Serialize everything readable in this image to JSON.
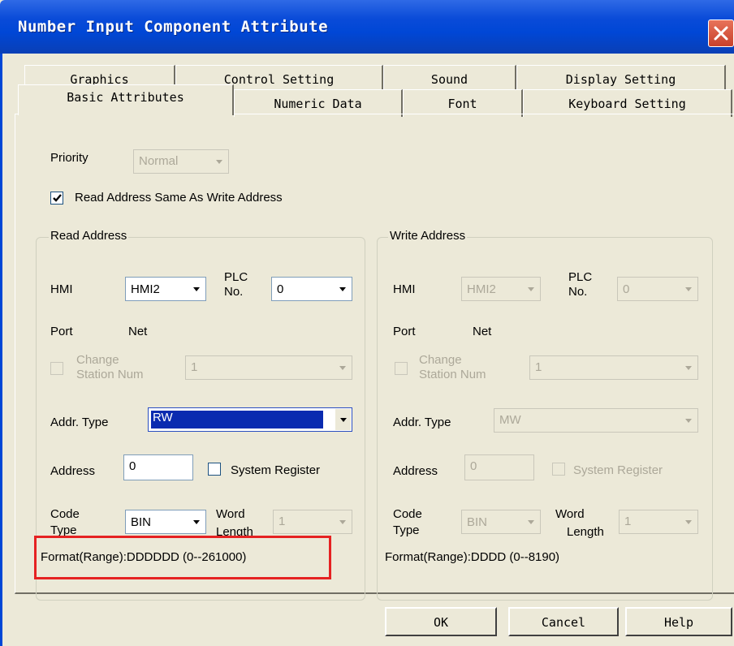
{
  "window": {
    "title": "Number Input Component Attribute"
  },
  "tabs": {
    "row1": [
      "Graphics",
      "Control Setting",
      "Sound",
      "Display Setting"
    ],
    "row2": [
      "Basic Attributes",
      "Numeric Data",
      "Font",
      "Keyboard Setting"
    ],
    "active": "Basic Attributes"
  },
  "priority": {
    "label": "Priority",
    "value": "Normal"
  },
  "same_address": {
    "label": "Read Address Same As Write Address",
    "checked": true
  },
  "read_address": {
    "title": "Read Address",
    "hmi_label": "HMI",
    "hmi_value": "HMI2",
    "plc_label_1": "PLC",
    "plc_label_2": "No.",
    "plc_value": "0",
    "port_label": "Port",
    "port_value": "Net",
    "change_station_1": "Change",
    "change_station_2": "Station Num",
    "station_value": "1",
    "addr_type_label": "Addr. Type",
    "addr_type_value": "RW",
    "address_label": "Address",
    "address_value": "0",
    "system_register_label": "System Register",
    "code_type_1": "Code",
    "code_type_2": "Type",
    "code_type_value": "BIN",
    "word_length_1": "Word",
    "word_length_2": "Length",
    "word_length_value": "1",
    "format": "Format(Range):DDDDDD (0--261000)"
  },
  "write_address": {
    "title": "Write Address",
    "hmi_label": "HMI",
    "hmi_value": "HMI2",
    "plc_label_1": "PLC",
    "plc_label_2": "No.",
    "plc_value": "0",
    "port_label": "Port",
    "port_value": "Net",
    "change_station_1": "Change",
    "change_station_2": "Station Num",
    "station_value": "1",
    "addr_type_label": "Addr. Type",
    "addr_type_value": "MW",
    "address_label": "Address",
    "address_value": "0",
    "system_register_label": "System Register",
    "code_type_1": "Code",
    "code_type_2": "Type",
    "code_type_value": "BIN",
    "word_length_1": "Word",
    "word_length_2": "Length",
    "word_length_value": "1",
    "format": "Format(Range):DDDD (0--8190)"
  },
  "buttons": {
    "ok": "OK",
    "cancel": "Cancel",
    "help": "Help"
  },
  "icons": {
    "close": "close-icon",
    "checkmark": "checkmark-icon",
    "dropdown": "chevron-down-icon"
  },
  "colors": {
    "title_bar": "#0047d6",
    "selection": "#0a2bb0",
    "highlight_box": "#e52222",
    "dialog_bg": "#ece9d8"
  }
}
